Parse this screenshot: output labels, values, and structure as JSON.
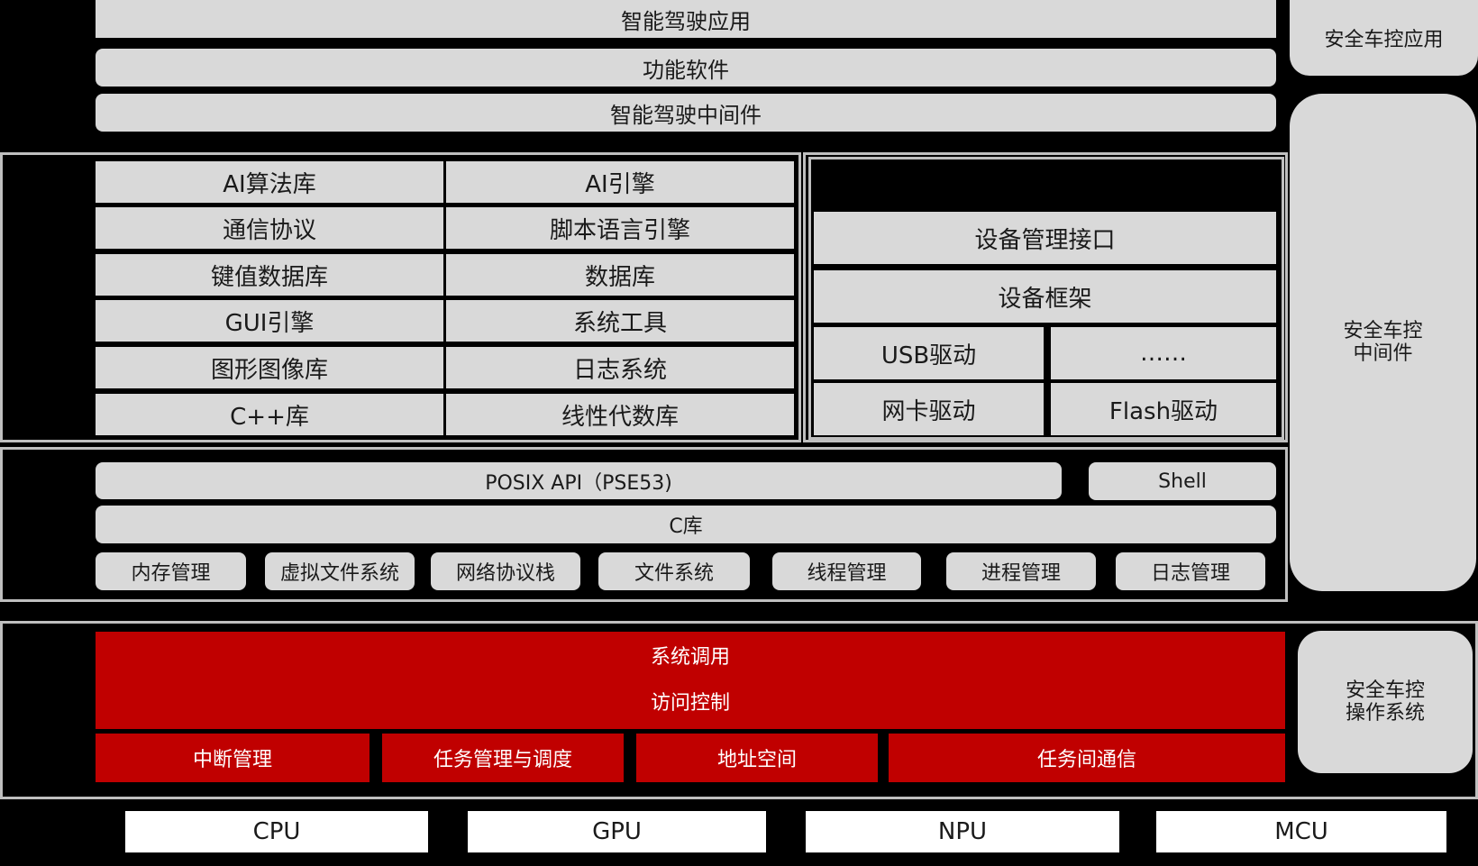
{
  "top_layers": {
    "app": "智能驾驶应用",
    "functional_software": "功能软件",
    "middleware": "智能驾驶中间件"
  },
  "safety_column": {
    "app": "安全车控应用",
    "middleware": [
      "安全车控",
      "中间件"
    ],
    "os": [
      "安全车控",
      "操作系统"
    ]
  },
  "libraries": {
    "left": [
      "AI算法库",
      "通信协议",
      "键值数据库",
      "GUI引擎",
      "图形图像库",
      "C++库"
    ],
    "right": [
      "AI引擎",
      "脚本语言引擎",
      "数据库",
      "系统工具",
      "日志系统",
      "线性代数库"
    ]
  },
  "device": {
    "interface": "设备管理接口",
    "framework": "设备框架",
    "drivers": [
      "USB驱动",
      "……",
      "网卡驱动",
      "Flash驱动"
    ]
  },
  "os_services": {
    "posix": "POSIX API（PSE53)",
    "shell": "Shell",
    "clib": "C库",
    "modules": [
      "内存管理",
      "虚拟文件系统",
      "网络协议栈",
      "文件系统",
      "线程管理",
      "进程管理",
      "日志管理"
    ]
  },
  "kernel": {
    "syscall": "系统调用",
    "access_control": "访问控制",
    "modules": [
      "中断管理",
      "任务管理与调度",
      "地址空间",
      "任务间通信"
    ]
  },
  "hardware": [
    "CPU",
    "GPU",
    "NPU",
    "MCU"
  ],
  "colors": {
    "panel": "#d9d9d9",
    "kernel": "#c00000",
    "frame": "#bfbfbf",
    "background": "#000000"
  }
}
